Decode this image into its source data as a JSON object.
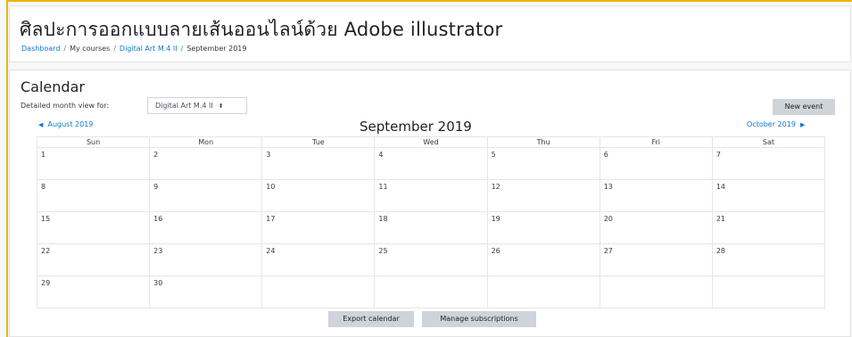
{
  "header": {
    "title": "ศิลปะการออกแบบลายเส้นออนไลน์ด้วย Adobe illustrator",
    "breadcrumb": {
      "dashboard": "Dashboard",
      "my_courses": "My courses",
      "course": "Digital Art M.4 II",
      "current": "September 2019",
      "separator": "/"
    }
  },
  "calendar": {
    "heading": "Calendar",
    "view_label": "Detailed month view for:",
    "selected_course": "Digital Art M.4 II",
    "new_event_label": "New event",
    "prev_month": "August 2019",
    "next_month": "October 2019",
    "month_title": "September 2019",
    "weekdays": [
      "Sun",
      "Mon",
      "Tue",
      "Wed",
      "Thu",
      "Fri",
      "Sat"
    ],
    "weeks": [
      [
        "1",
        "2",
        "3",
        "4",
        "5",
        "6",
        "7"
      ],
      [
        "8",
        "9",
        "10",
        "11",
        "12",
        "13",
        "14"
      ],
      [
        "15",
        "16",
        "17",
        "18",
        "19",
        "20",
        "21"
      ],
      [
        "22",
        "23",
        "24",
        "25",
        "26",
        "27",
        "28"
      ],
      [
        "29",
        "30",
        "",
        "",
        "",
        "",
        ""
      ]
    ],
    "export_label": "Export calendar",
    "subscriptions_label": "Manage subscriptions"
  },
  "colors": {
    "accent_border": "#f0b400",
    "link": "#1177d1",
    "button_bg": "#ced4da"
  }
}
